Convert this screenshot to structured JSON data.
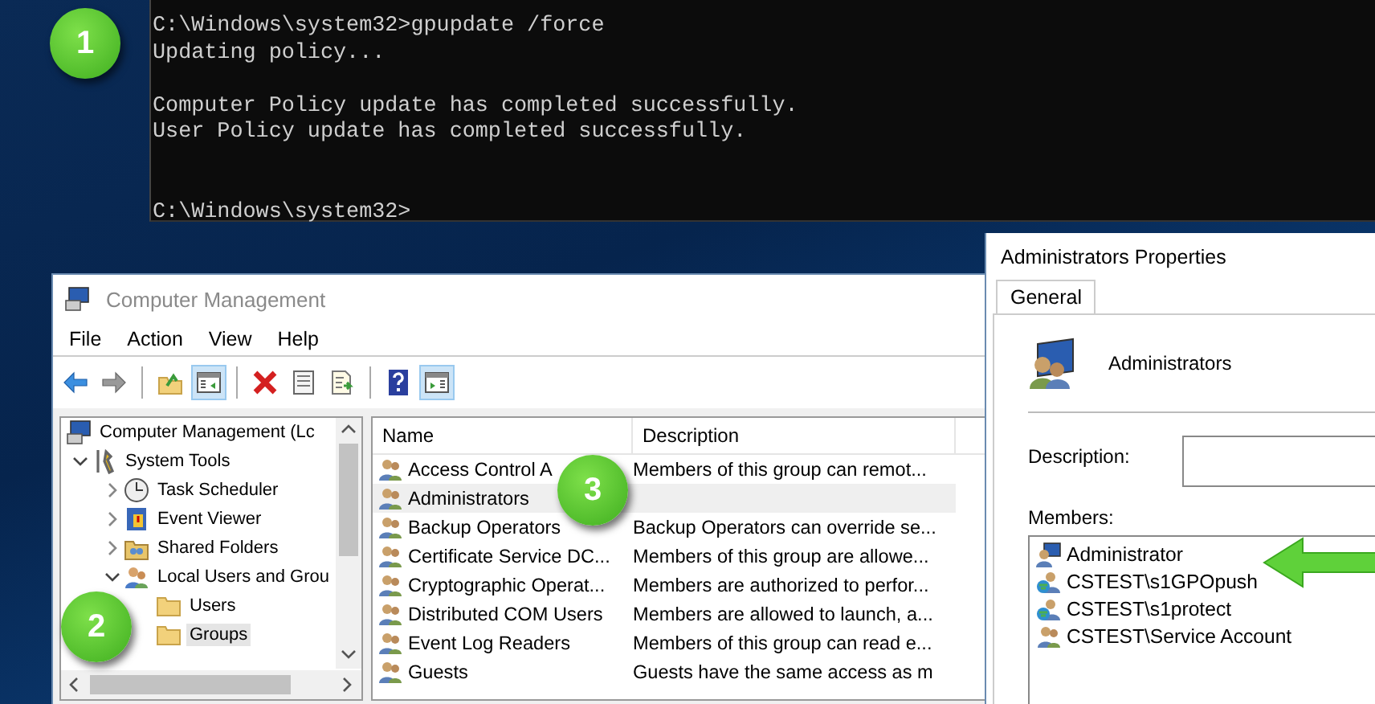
{
  "console": {
    "command_line": "C:\\Windows\\system32>gpupdate /force",
    "progress": "Updating policy...",
    "results": [
      "Computer Policy update has completed successfully.",
      "User Policy update has completed successfully."
    ],
    "prompt": "C:\\Windows\\system32>"
  },
  "computer_management": {
    "title": "Computer Management",
    "menu": [
      "File",
      "Action",
      "View",
      "Help"
    ],
    "toolbar": [
      {
        "kind": "back",
        "pressed": false
      },
      {
        "kind": "forward",
        "pressed": false
      },
      {
        "kind": "sep"
      },
      {
        "kind": "up",
        "pressed": false
      },
      {
        "kind": "tree",
        "pressed": true
      },
      {
        "kind": "sep"
      },
      {
        "kind": "delete",
        "pressed": false
      },
      {
        "kind": "properties",
        "pressed": false
      },
      {
        "kind": "export",
        "pressed": false
      },
      {
        "kind": "sep"
      },
      {
        "kind": "help",
        "pressed": false
      },
      {
        "kind": "action",
        "pressed": true
      }
    ],
    "tree": [
      {
        "label": "Computer Management (Lc",
        "kind": "computer",
        "selected": false,
        "children": [
          {
            "label": "System Tools",
            "kind": "tools",
            "expanded": true,
            "selected": false,
            "children": [
              {
                "label": "Task Scheduler",
                "kind": "scheduler",
                "expanded": false,
                "selected": false
              },
              {
                "label": "Event Viewer",
                "kind": "viewer",
                "expanded": false,
                "selected": false
              },
              {
                "label": "Shared Folders",
                "kind": "share",
                "expanded": false,
                "selected": false
              },
              {
                "label": "Local Users and Grou",
                "kind": "users",
                "expanded": true,
                "selected": false,
                "children": [
                  {
                    "label": "Users",
                    "kind": "folder",
                    "selected": false
                  },
                  {
                    "label": "Groups",
                    "kind": "folder",
                    "selected": true
                  }
                ]
              }
            ]
          }
        ]
      }
    ],
    "columns": [
      "Name",
      "Description"
    ],
    "rows": [
      {
        "name": "Access Control A",
        "description": "Members of this group can remot...",
        "selected": false
      },
      {
        "name": "Administrators",
        "description": "",
        "selected": true
      },
      {
        "name": "Backup Operators",
        "description": "Backup Operators can override se...",
        "selected": false
      },
      {
        "name": "Certificate Service DC...",
        "description": "Members of this group are allowe...",
        "selected": false
      },
      {
        "name": "Cryptographic Operat...",
        "description": "Members are authorized to perfor...",
        "selected": false
      },
      {
        "name": "Distributed COM Users",
        "description": "Members are allowed to launch, a...",
        "selected": false
      },
      {
        "name": "Event Log Readers",
        "description": "Members of this group can read e...",
        "selected": false
      },
      {
        "name": "Guests",
        "description": "Guests have the same access as m",
        "selected": false
      }
    ]
  },
  "properties": {
    "title": "Administrators Properties",
    "tabs": [
      {
        "label": "General",
        "selected": true
      }
    ],
    "group_name": "Administrators",
    "description_label": "Description:",
    "members_label": "Members:",
    "members": [
      {
        "name": "Administrator",
        "kind": "local"
      },
      {
        "name": "CSTEST\\s1GPOpush",
        "kind": "domain"
      },
      {
        "name": "CSTEST\\s1protect",
        "kind": "domain"
      },
      {
        "name": "CSTEST\\Service Account",
        "kind": "group"
      }
    ]
  },
  "badges": [
    "1",
    "2",
    "3"
  ]
}
